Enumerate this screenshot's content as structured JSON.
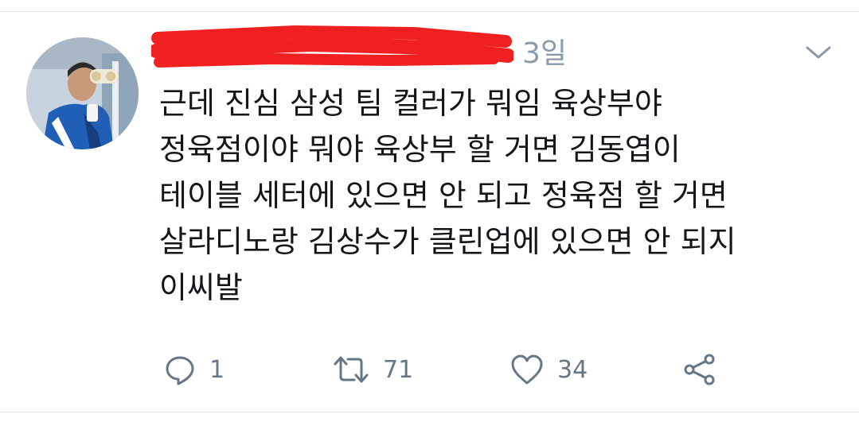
{
  "tweet": {
    "timestamp": "3일",
    "body_lines": [
      "근데 진심 삼성 팀 컬러가 뭐임 육상부야",
      "정육점이야 뭐야 육상부 할 거면 김동엽이",
      "테이블 세터에 있으면 안 되고 정육점 할 거면",
      "살라디노랑 김상수가 클린업에 있으면 안 되지",
      "이씨발"
    ]
  },
  "actions": {
    "reply_count": "1",
    "retweet_count": "71",
    "like_count": "34"
  },
  "icons": {
    "reply": "reply-icon",
    "retweet": "retweet-icon",
    "like": "heart-icon",
    "share": "share-icon",
    "menu": "chevron-down-icon"
  },
  "colors": {
    "text": "#14171a",
    "muted": "#657786",
    "redaction": "#f02020"
  }
}
